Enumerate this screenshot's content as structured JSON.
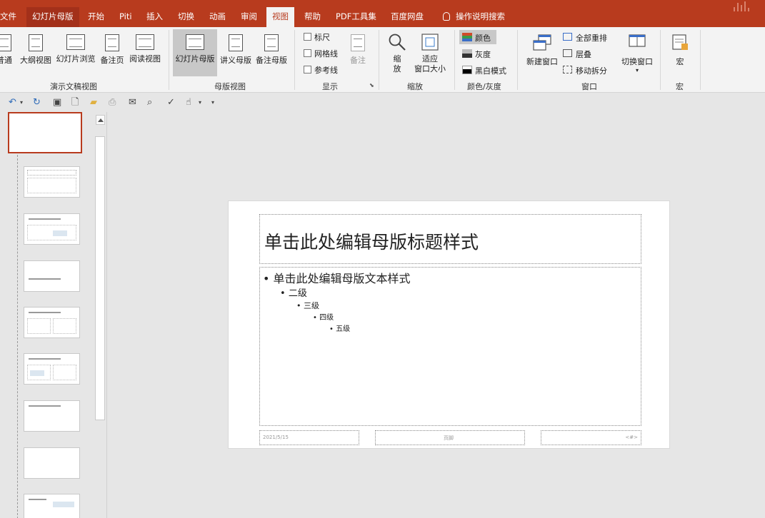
{
  "tabs": [
    "文件",
    "幻灯片母版",
    "开始",
    "Piti",
    "插入",
    "切换",
    "动画",
    "审阅",
    "视图",
    "帮助",
    "PDF工具集",
    "百度网盘",
    "操作说明搜索"
  ],
  "ribbon": {
    "presentation_views": {
      "buttons": [
        "普通",
        "大纲视图",
        "幻灯片浏览",
        "备注页",
        "阅读视图"
      ],
      "group_label": "演示文稿视图"
    },
    "master_views": {
      "buttons": [
        "幻灯片母版",
        "讲义母版",
        "备注母版"
      ],
      "group_label": "母版视图"
    },
    "show": {
      "checkboxes": [
        "标尺",
        "网格线",
        "参考线"
      ],
      "notes_button": "备注",
      "group_label": "显示"
    },
    "zoom": {
      "zoom_button": [
        "缩",
        "放"
      ],
      "fit_button": [
        "适应",
        "窗口大小"
      ],
      "group_label": "缩放"
    },
    "color": {
      "options": [
        "颜色",
        "灰度",
        "黑白模式"
      ],
      "group_label": "颜色/灰度"
    },
    "window": {
      "new_window": "新建窗口",
      "options": [
        "全部重排",
        "层叠",
        "移动拆分"
      ],
      "switch_window": "切换窗口",
      "group_label": "窗口"
    },
    "macros": {
      "button": "宏",
      "group_label": "宏"
    }
  },
  "slide": {
    "title": "单击此处编辑母版标题样式",
    "body_levels": [
      "单击此处编辑母版文本样式",
      "二级",
      "三级",
      "四级",
      "五级"
    ],
    "footer_date": "2021/5/15",
    "footer_center": "页脚",
    "footer_num": "<#>"
  },
  "colors": {
    "accent": "#b83b1e",
    "tab_active_bg": "#f3f3f3",
    "ribbon_bg": "#f3f3f3",
    "workspace_bg": "#e6e6e6"
  }
}
